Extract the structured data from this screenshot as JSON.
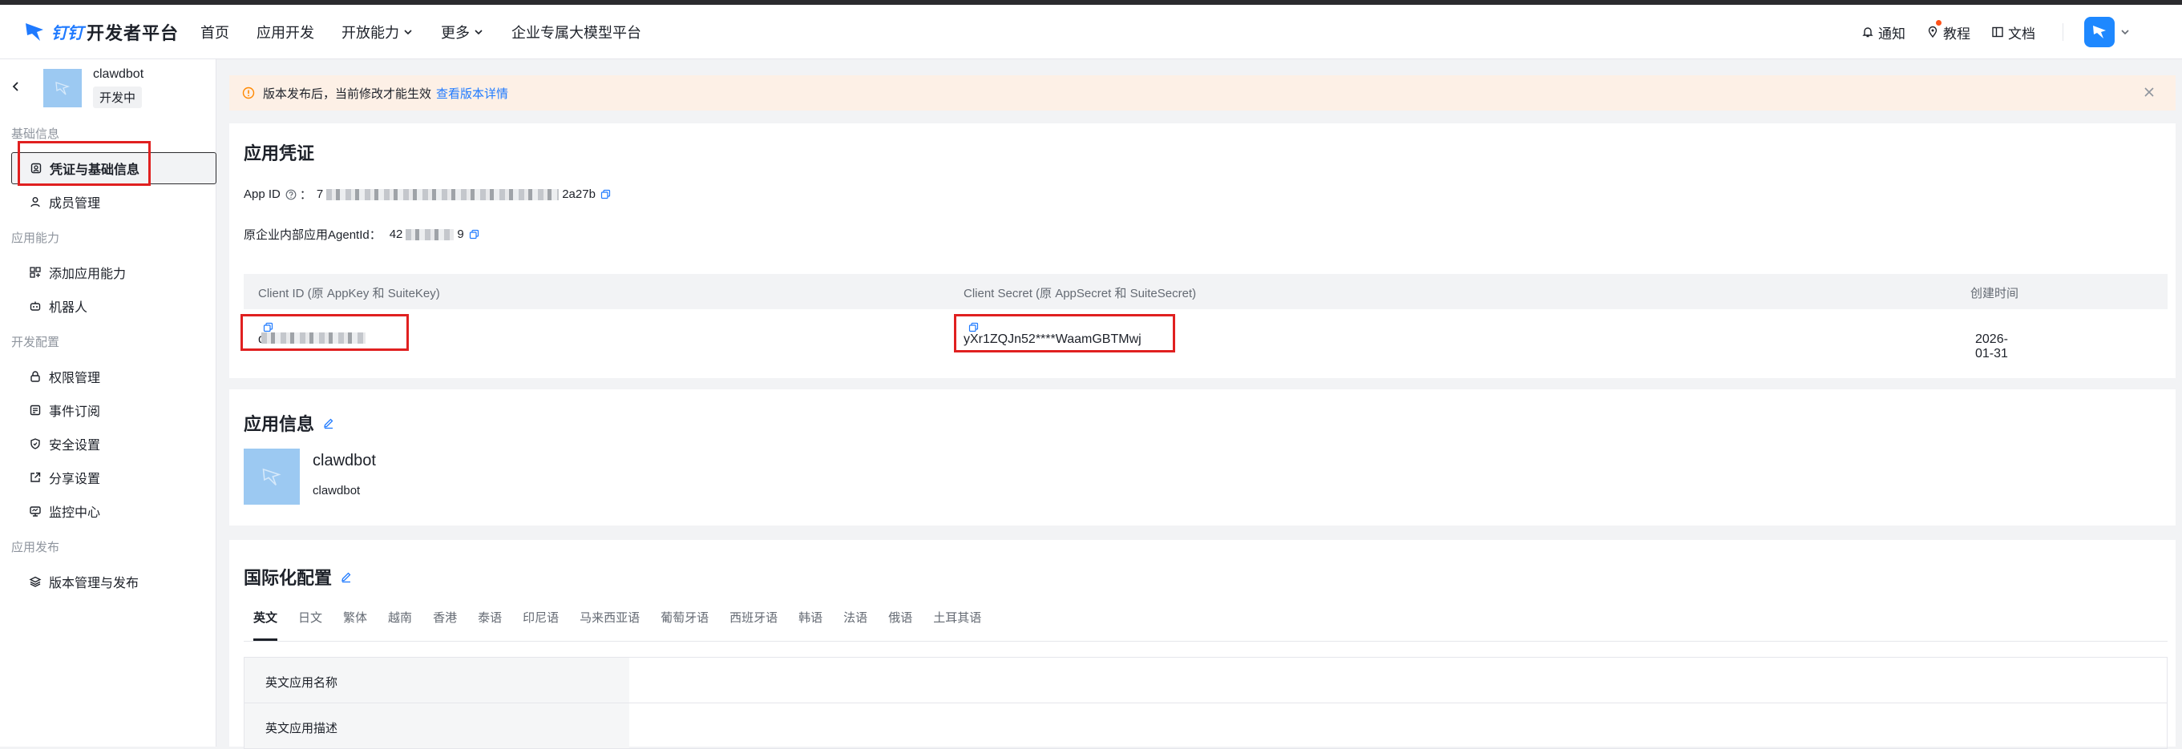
{
  "brand": {
    "name": "开发者平台"
  },
  "nav": {
    "links": [
      {
        "label": "首页"
      },
      {
        "label": "应用开发"
      },
      {
        "label": "开放能力"
      },
      {
        "label": "更多"
      },
      {
        "label": "企业专属大模型平台"
      }
    ],
    "notify": "通知",
    "tutorial": "教程",
    "docs": "文档"
  },
  "sidebar": {
    "app_name": "clawdbot",
    "app_status": "开发中",
    "groups": [
      {
        "title": "基础信息",
        "items": [
          {
            "label": "凭证与基础信息",
            "icon": "credential-icon"
          },
          {
            "label": "成员管理",
            "icon": "user-icon"
          }
        ]
      },
      {
        "title": "应用能力",
        "items": [
          {
            "label": "添加应用能力",
            "icon": "apps-icon"
          },
          {
            "label": "机器人",
            "icon": "robot-icon"
          }
        ]
      },
      {
        "title": "开发配置",
        "items": [
          {
            "label": "权限管理",
            "icon": "lock-icon"
          },
          {
            "label": "事件订阅",
            "icon": "event-icon"
          },
          {
            "label": "安全设置",
            "icon": "shield-icon"
          },
          {
            "label": "分享设置",
            "icon": "share-icon"
          },
          {
            "label": "监控中心",
            "icon": "monitor-icon"
          }
        ]
      },
      {
        "title": "应用发布",
        "items": [
          {
            "label": "版本管理与发布",
            "icon": "layers-icon"
          }
        ]
      }
    ]
  },
  "banner": {
    "text": "版本发布后，当前修改才能生效",
    "link": "查看版本详情"
  },
  "credentials": {
    "title": "应用凭证",
    "app_id_label": "App ID",
    "app_id_prefix": "7",
    "app_id_suffix": "2a27b",
    "agent_label": "原企业内部应用AgentId：",
    "agent_prefix": "42",
    "agent_suffix": "9",
    "table": {
      "headers": [
        "Client ID (原 AppKey 和 SuiteKey)",
        "Client Secret (原 AppSecret 和 SuiteSecret)",
        "创建时间"
      ],
      "client_id_prefix": "din",
      "client_secret": "yXr1ZQJn52****WaamGBTMwj",
      "created": "2026-01-31"
    }
  },
  "app_info": {
    "title": "应用信息",
    "name": "clawdbot",
    "desc": "clawdbot"
  },
  "i18n": {
    "title": "国际化配置",
    "tabs": [
      "英文",
      "日文",
      "繁体",
      "越南",
      "香港",
      "泰语",
      "印尼语",
      "马来西亚语",
      "葡萄牙语",
      "西班牙语",
      "韩语",
      "法语",
      "俄语",
      "土耳其语"
    ],
    "rows": [
      "英文应用名称",
      "英文应用描述"
    ]
  },
  "colors": {
    "accent": "#1f7aff",
    "highlight": "#e02020",
    "banner_bg": "#fdf0e6"
  }
}
